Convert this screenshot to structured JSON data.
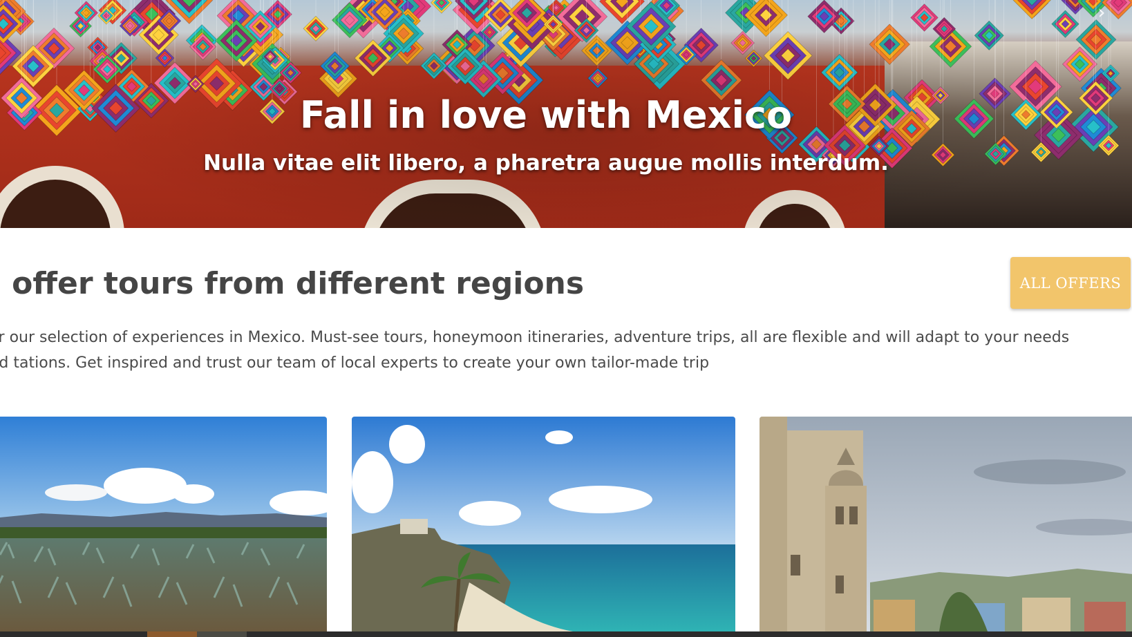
{
  "hero": {
    "title": "Fall in love with Mexico",
    "subtitle": "Nulla vitae elit libero, a pharetra augue mollis interdum.",
    "next_icon": "chevron-right-icon"
  },
  "intro": {
    "heading": "e offer tours from different regions",
    "button_label": "ALL OFFERS",
    "button_color": "#f2c56b",
    "text": "ver our selection of experiences in Mexico. Must-see tours, honeymoon itineraries, adventure trips, all are flexible and will adapt to your needs and tations. Get inspired and trust our team of local experts to create your own tailor-made trip"
  },
  "cards": [
    {
      "image": "agave-field-photo"
    },
    {
      "image": "caribbean-beach-ruins-photo"
    },
    {
      "image": "colonial-church-town-photo"
    }
  ]
}
